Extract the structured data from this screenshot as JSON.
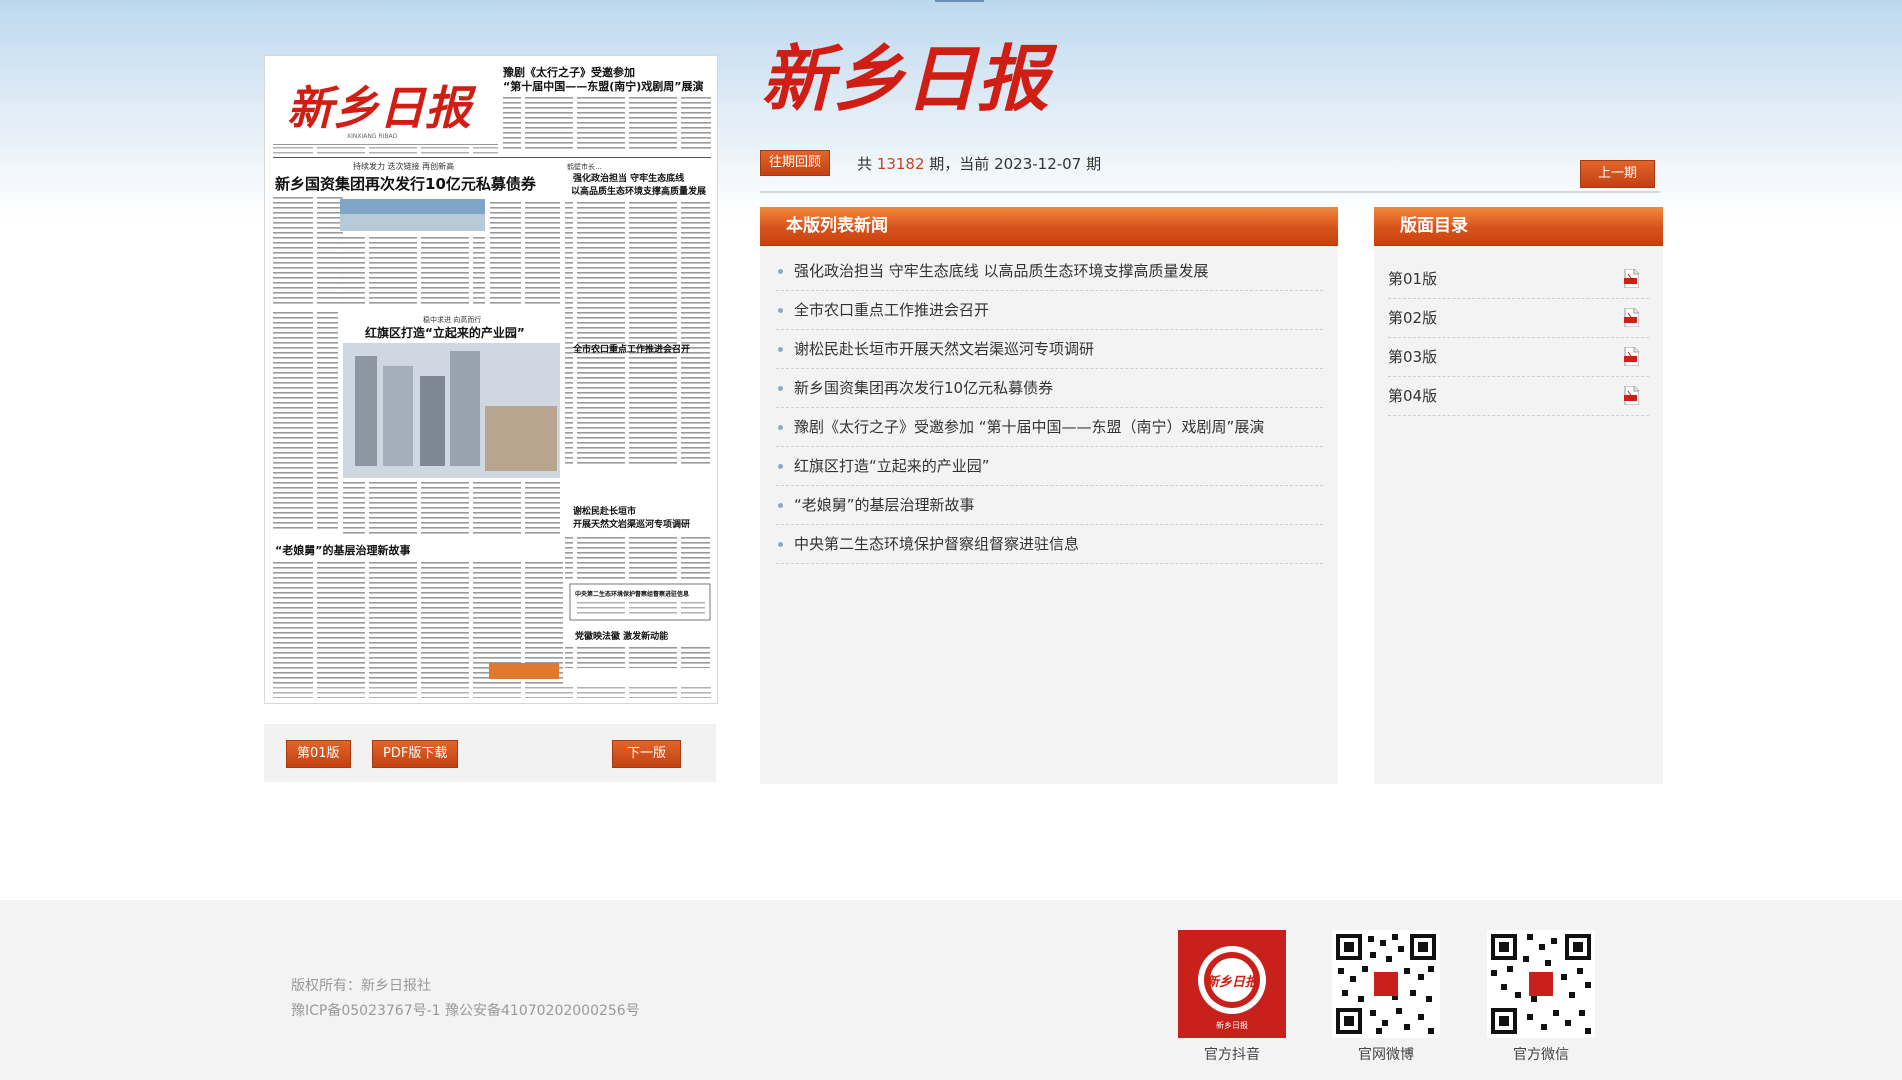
{
  "masthead": {
    "title": "新乡日报"
  },
  "paper": {
    "headline_left_top": "豫剧《太行之子》受邀参加",
    "headline_left_top2": "“第十届中国——东盟(南宁)戏剧周”展演",
    "lead_kicker": "持续发力 迭次链接 再创新高",
    "lead_headline": "新乡国资集团再次发行10亿元私募债券",
    "right_kicker": "强化政治担当 守牢生态底线",
    "right_headline": "以高品质生态环境支撑高质量发展",
    "mid_kicker": "稳中求进 向高而行",
    "mid_headline": "红旗区打造“立起来的产业园”",
    "right2_headline": "全市农口重点工作推进会召开",
    "right3_headline": "谢松民赴长垣市",
    "right3_headline2": "开展天然文岩渠巡河专项调研",
    "bottom_headline": "“老娘舅”的基层治理新故事",
    "box_title": "中央第二生态环境保护督察组督察进驻信息",
    "bottom_right": "党徽映法徽 激发新动能"
  },
  "paper_controls": {
    "page_button": "第01版",
    "pdf_button": "PDF版下载",
    "next_button": "下一版"
  },
  "period": {
    "archive_button": "往期回顾",
    "prefix": "共",
    "total": "13182",
    "mid": "期，当前",
    "date": "2023-12-07",
    "suffix": "期",
    "prev_button": "上一期"
  },
  "news_panel": {
    "title": "本版列表新闻",
    "items": [
      "强化政治担当 守牢生态底线 以高品质生态环境支撑高质量发展",
      "全市农口重点工作推进会召开",
      "谢松民赴长垣市开展天然文岩渠巡河专项调研",
      "新乡国资集团再次发行10亿元私募债券",
      "豫剧《太行之子》受邀参加 “第十届中国——东盟（南宁）戏剧周”展演",
      "红旗区打造“立起来的产业园”",
      "“老娘舅”的基层治理新故事",
      "中央第二生态环境保护督察组督察进驻信息"
    ]
  },
  "toc_panel": {
    "title": "版面目录",
    "items": [
      "第01版",
      "第02版",
      "第03版",
      "第04版"
    ]
  },
  "footer": {
    "copyright": "版权所有：新乡日报社",
    "icp": "豫ICP备05023767号-1 豫公安备41070202000256号",
    "qrs": [
      "官方抖音",
      "官网微博",
      "官方微信"
    ],
    "douyin_label": "新乡日报"
  },
  "colors": {
    "accent": "#d8521c",
    "masthead_red": "#d01e14"
  }
}
